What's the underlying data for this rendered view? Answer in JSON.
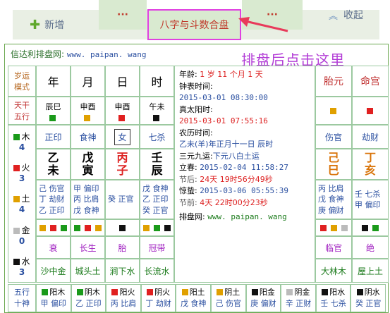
{
  "toolbar": {
    "add_label": "新增",
    "dots_left": "···",
    "center_label": "八字与斗数合盘",
    "dots_right": "···",
    "fold_label": "收起"
  },
  "header": {
    "site_label": "信达利排盘网:",
    "site_url": "www. paipan. wang"
  },
  "overlay": {
    "text": "排盘后点击这里"
  },
  "left_labels": {
    "suiyun": "岁运\n模式",
    "tiangan": "天干\n五行",
    "wuxing": "五行",
    "shishen": "十神"
  },
  "pillars": {
    "headers": [
      "年",
      "月",
      "日",
      "时"
    ],
    "gz_tags": [
      "辰巳",
      "申酉",
      "申酉",
      "午未"
    ],
    "gods": [
      "正印",
      "食神",
      "女",
      "七杀"
    ],
    "stems": [
      "乙",
      "戊",
      "丙",
      "壬"
    ],
    "branches": [
      "未",
      "寅",
      "子",
      "辰"
    ],
    "hidden": [
      [
        "己 伤官",
        "丁 劫财",
        "乙 正印"
      ],
      [
        "甲 偏印",
        "丙 比肩",
        "戊 食神"
      ],
      [
        "癸 正官",
        "",
        ""
      ],
      [
        "戊 食神",
        "乙 正印",
        "癸 正官"
      ]
    ],
    "life_stage": [
      "衰",
      "长生",
      "胎",
      "冠带"
    ],
    "nayin": [
      "沙中金",
      "城头土",
      "涧下水",
      "长流水"
    ]
  },
  "elements": [
    {
      "name": "木",
      "count": "4",
      "color": "#1a9a1a"
    },
    {
      "name": "火",
      "count": "3",
      "color": "#e02020"
    },
    {
      "name": "土",
      "count": "4",
      "color": "#e0a000"
    },
    {
      "name": "金",
      "count": "0",
      "color": "#bbbbbb"
    },
    {
      "name": "水",
      "count": "3",
      "color": "#111111"
    }
  ],
  "center": {
    "age_label": "年龄:",
    "age_value": "1 岁 11 个月 1 天",
    "clock_label": "钟表时间:",
    "clock_value": "2015-03-01 08:30:00",
    "solar_label": "真太阳时:",
    "solar_value": "2015-03-01 07:55:16",
    "lunar_label": "农历时间:",
    "lunar_value": "乙未(羊)年正月十一日 辰时",
    "sanyuan_label": "三元九运:",
    "sanyuan_value": "下元八白土运",
    "lichun_label": "立春:",
    "lichun_value": "2015-02-04 11:58:27",
    "after_label": "节后:",
    "after_value": "24天 19时56分49秒",
    "jingzhe_label": "惊蛰:",
    "jingzhe_value": "2015-03-06 05:55:39",
    "before_label": "节前:",
    "before_value": "4天 22时00分23秒",
    "footer_label": "排盘网:",
    "footer_url": "www. paipan. wang"
  },
  "right": {
    "headers": [
      "胎元",
      "命宫"
    ],
    "gods": [
      "伤官",
      "劫财"
    ],
    "stems": [
      "己",
      "丁"
    ],
    "branches": [
      "巳",
      "亥"
    ],
    "hidden": [
      [
        "丙 比肩",
        "戊 食神",
        "庚 偏财"
      ],
      [
        "壬 七杀",
        "甲 偏印",
        ""
      ]
    ],
    "life_stage": [
      "临官",
      "绝"
    ],
    "nayin": [
      "大林木",
      "屋上土"
    ]
  },
  "bottom_row": [
    {
      "label": "阳木",
      "sub": "甲 偏印"
    },
    {
      "label": "阴木",
      "sub": "乙 正印"
    },
    {
      "label": "阳火",
      "sub": "丙 比肩"
    },
    {
      "label": "阴火",
      "sub": "丁 劫财"
    },
    {
      "label": "阳土",
      "sub": "戊 食神"
    },
    {
      "label": "阴土",
      "sub": "己 伤官"
    },
    {
      "label": "阳金",
      "sub": "庚 偏财"
    },
    {
      "label": "阴金",
      "sub": "辛 正财"
    },
    {
      "label": "阳水",
      "sub": "壬 七杀"
    },
    {
      "label": "阴水",
      "sub": "癸 正官"
    }
  ]
}
